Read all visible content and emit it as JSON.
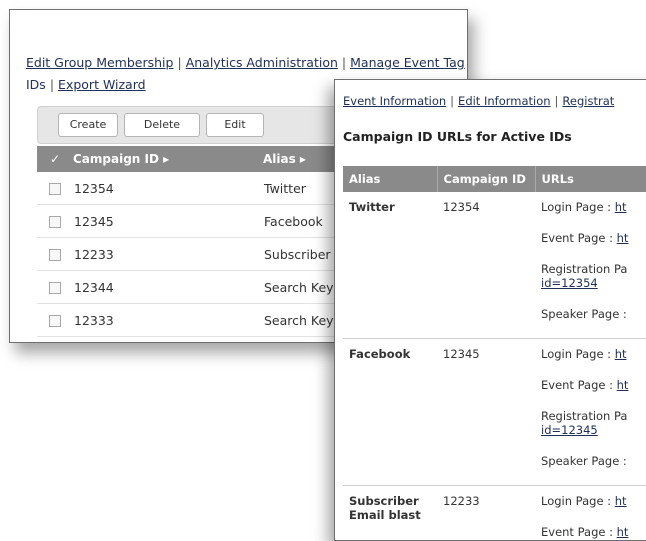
{
  "back_window": {
    "nav_line1": [
      "Edit Group Membership",
      "Analytics Administration",
      "Manage Event Tag"
    ],
    "nav_line2": [
      "IDs",
      "Export Wizard"
    ],
    "toolbar": {
      "create": "Create",
      "delete": "Delete",
      "edit": "Edit"
    },
    "columns": {
      "check": "✓",
      "campaign_id": "Campaign ID ▸",
      "alias": "Alias ▸"
    },
    "rows": [
      {
        "campaign_id": "12354",
        "alias": "Twitter"
      },
      {
        "campaign_id": "12345",
        "alias": "Facebook"
      },
      {
        "campaign_id": "12233",
        "alias": "Subscriber E"
      },
      {
        "campaign_id": "12344",
        "alias": "Search Keyw"
      },
      {
        "campaign_id": "12333",
        "alias": "Search Keyw"
      }
    ]
  },
  "front_window": {
    "nav": [
      "Event Information",
      "Edit Information",
      "Registrat"
    ],
    "heading": "Campaign ID URLs for Active IDs",
    "columns": {
      "alias": "Alias",
      "campaign_id": "Campaign ID",
      "urls": "URLs"
    },
    "groups": [
      {
        "alias": "Twitter",
        "campaign_id": "12354",
        "urls": [
          {
            "label": "Login Page : ",
            "link": "ht"
          },
          {
            "label": "Event Page : ",
            "link": "ht"
          },
          {
            "label": "Registration Pa",
            "link": "id=12354"
          },
          {
            "label": "Speaker Page :",
            "link": ""
          }
        ]
      },
      {
        "alias": "Facebook",
        "campaign_id": "12345",
        "urls": [
          {
            "label": "Login Page : ",
            "link": "ht"
          },
          {
            "label": "Event Page : ",
            "link": "ht"
          },
          {
            "label": "Registration Pa",
            "link": "id=12345"
          },
          {
            "label": "Speaker Page :",
            "link": ""
          }
        ]
      },
      {
        "alias": "Subscriber Email blast",
        "campaign_id": "12233",
        "urls": [
          {
            "label": "Login Page : ",
            "link": "ht"
          },
          {
            "label": "Event Page : ",
            "link": "ht"
          }
        ]
      }
    ]
  }
}
